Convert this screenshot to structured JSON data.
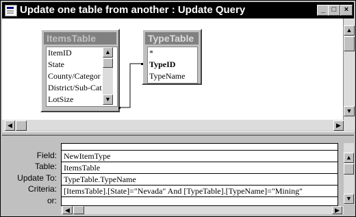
{
  "window": {
    "title": "Update one table from another : Update Query",
    "minimize_glyph": "_",
    "maximize_glyph": "□",
    "close_glyph": "×"
  },
  "tables": {
    "items_table": {
      "name": "ItemsTable",
      "fields": [
        "ItemID",
        "State",
        "County/Categor",
        "District/Sub-Cat",
        "LotSize"
      ]
    },
    "type_table": {
      "name": "TypeTable",
      "fields": [
        "*",
        "TypeID",
        "TypeName"
      ]
    }
  },
  "grid": {
    "row_labels": {
      "field": "Field:",
      "table": "Table:",
      "update_to": "Update To:",
      "criteria": "Criteria:",
      "or": "or:"
    },
    "column1": {
      "field": "NewItemType",
      "table": "ItemsTable",
      "update_to": "TypeTable.TypeName",
      "criteria": "[ItemsTable].[State]=\"Nevada\" And [TypeTable].[TypeName]=\"Mining\"",
      "or": ""
    }
  },
  "scroll_glyphs": {
    "up": "▲",
    "down": "▼",
    "left": "◀",
    "right": "▶"
  },
  "colors": {
    "title_bar": "#000000",
    "face": "#c0c0c0",
    "table_header": "#808080"
  }
}
